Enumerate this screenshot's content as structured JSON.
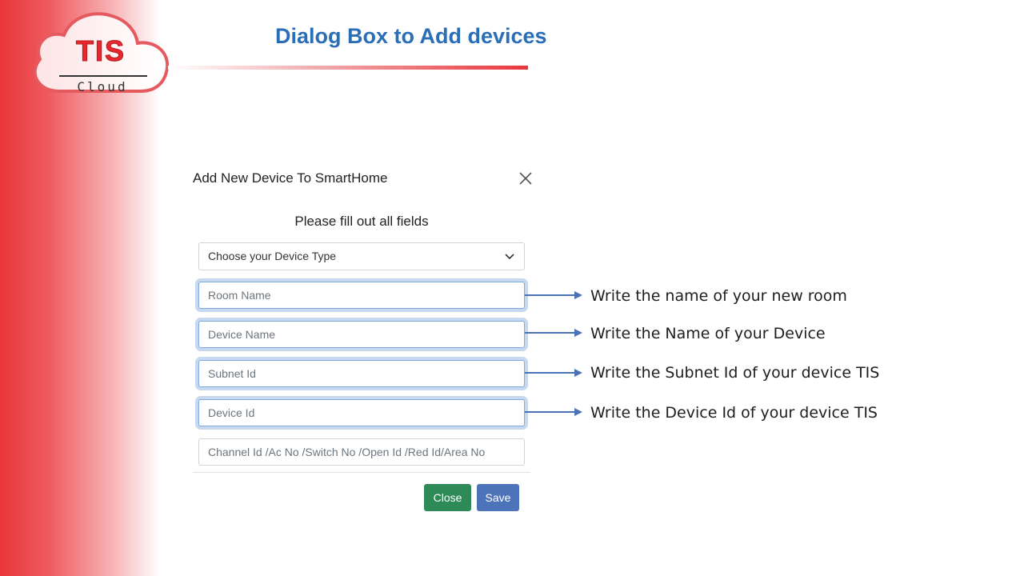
{
  "slide": {
    "title": "Dialog Box to Add devices"
  },
  "logo": {
    "brand": "TIS",
    "sub": "Cloud"
  },
  "dialog": {
    "title": "Add New Device To SmartHome",
    "subtitle": "Please fill out all fields",
    "device_type_select": "Choose your Device Type",
    "fields": {
      "room_name": "Room Name",
      "device_name": "Device Name",
      "subnet_id": "Subnet Id",
      "device_id": "Device Id",
      "channel_id": "Channel Id /Ac No /Switch No /Open Id /Red Id/Area No"
    },
    "buttons": {
      "close": "Close",
      "save": "Save"
    }
  },
  "annotations": {
    "room_name": "Write the name of your new room",
    "device_name": "Write the Name of your Device",
    "subnet_id": "Write the Subnet Id of your device TIS",
    "device_id": "Write the Device Id of your device TIS"
  },
  "colors": {
    "brand_red": "#e8363b",
    "title_blue": "#2a6eb8",
    "close_green": "#2e8b57",
    "save_blue": "#4d73b8",
    "arrow_blue": "#4a72b4"
  }
}
